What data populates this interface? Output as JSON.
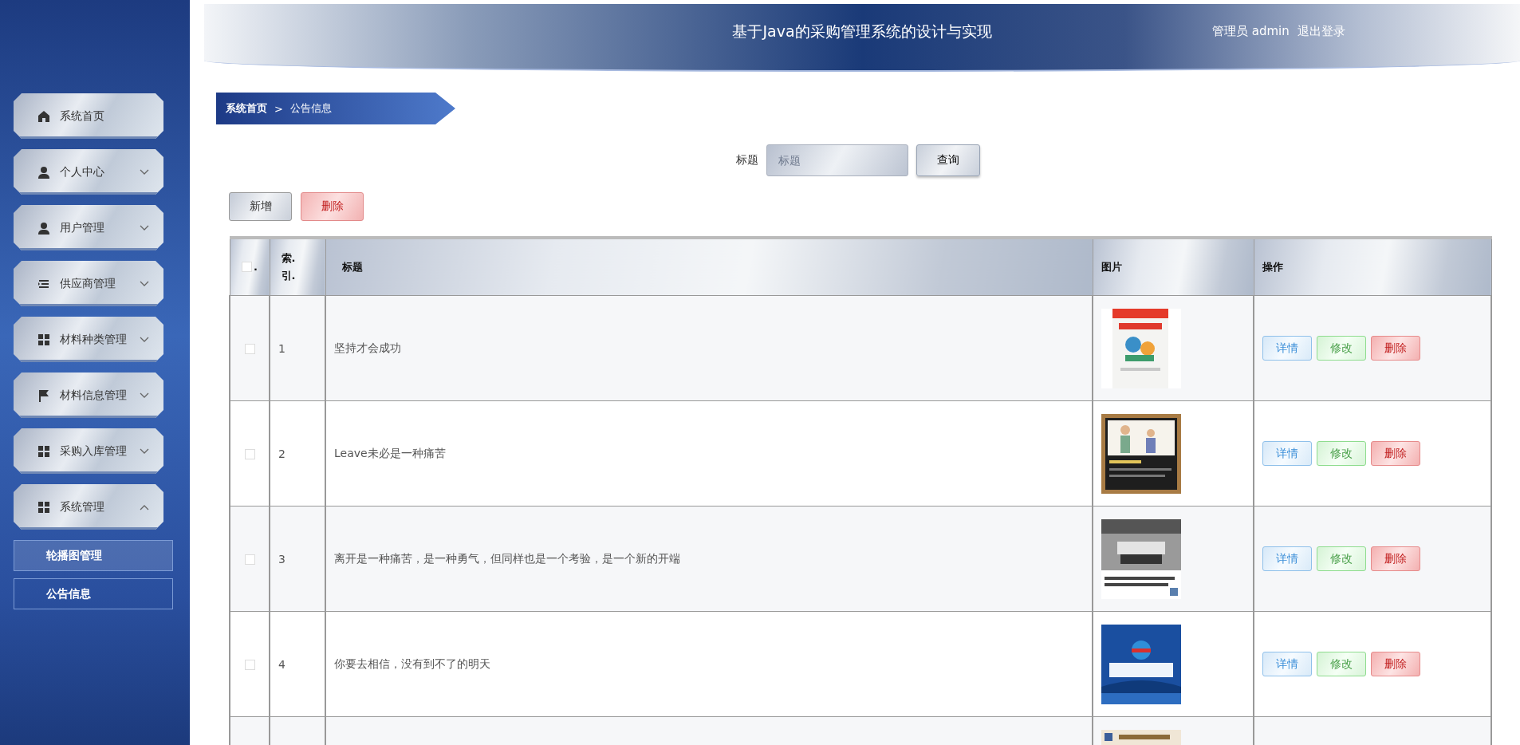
{
  "sidebar": {
    "items": [
      {
        "label": "系统首页",
        "kind": "link"
      },
      {
        "label": "个人中心",
        "kind": "group",
        "expanded": false
      },
      {
        "label": "用户管理",
        "kind": "group",
        "expanded": false
      },
      {
        "label": "供应商管理",
        "kind": "group",
        "expanded": false
      },
      {
        "label": "材料种类管理",
        "kind": "group",
        "expanded": false
      },
      {
        "label": "材料信息管理",
        "kind": "group",
        "expanded": false
      },
      {
        "label": "采购入库管理",
        "kind": "group",
        "expanded": false
      },
      {
        "label": "系统管理",
        "kind": "group",
        "expanded": true,
        "children": [
          {
            "label": "轮播图管理",
            "selected": true
          },
          {
            "label": "公告信息",
            "selected": false
          }
        ]
      }
    ]
  },
  "header": {
    "title": "基于Java的采购管理系统的设计与实现",
    "user": "管理员 admin",
    "logout": "退出登录"
  },
  "breadcrumb": {
    "home": "系统首页",
    "separator": ">",
    "current": "公告信息"
  },
  "search": {
    "label": "标题",
    "placeholder": "标题",
    "button": "查询"
  },
  "toolbar": [
    {
      "label": "新增",
      "kind": "add"
    },
    {
      "label": "删除",
      "kind": "delete"
    }
  ],
  "table": {
    "columns": [
      {
        "label": ".",
        "kind": "check",
        "checked": false
      },
      {
        "label": "索.引.",
        "kind": "index"
      },
      {
        "label": "标题",
        "kind": "text"
      },
      {
        "label": "图片",
        "kind": "text"
      },
      {
        "label": "操作",
        "kind": "text"
      }
    ],
    "rows": [
      {
        "checked": false,
        "index": "1",
        "title": "坚持才会成功",
        "image": {
          "kind": "picture"
        },
        "actions": [
          {
            "label": "详情",
            "kind": "detail"
          },
          {
            "label": "修改",
            "kind": "edit"
          },
          {
            "label": "删除",
            "kind": "delete"
          }
        ]
      },
      {
        "checked": false,
        "index": "2",
        "title": "Leave未必是一种痛苦",
        "image": {
          "kind": "picture"
        },
        "actions": [
          {
            "label": "详情",
            "kind": "detail"
          },
          {
            "label": "修改",
            "kind": "edit"
          },
          {
            "label": "删除",
            "kind": "delete"
          }
        ]
      },
      {
        "checked": false,
        "index": "3",
        "title": "离开是一种痛苦，是一种勇气，但同样也是一个考验，是一个新的开端",
        "image": {
          "kind": "picture"
        },
        "actions": [
          {
            "label": "详情",
            "kind": "detail"
          },
          {
            "label": "修改",
            "kind": "edit"
          },
          {
            "label": "删除",
            "kind": "delete"
          }
        ]
      },
      {
        "checked": false,
        "index": "4",
        "title": "你要去相信，没有到不了的明天",
        "image": {
          "kind": "picture"
        },
        "actions": [
          {
            "label": "详情",
            "kind": "detail"
          },
          {
            "label": "修改",
            "kind": "edit"
          },
          {
            "label": "删除",
            "kind": "delete"
          }
        ]
      },
      {
        "image": {
          "kind": "picture"
        }
      }
    ]
  }
}
